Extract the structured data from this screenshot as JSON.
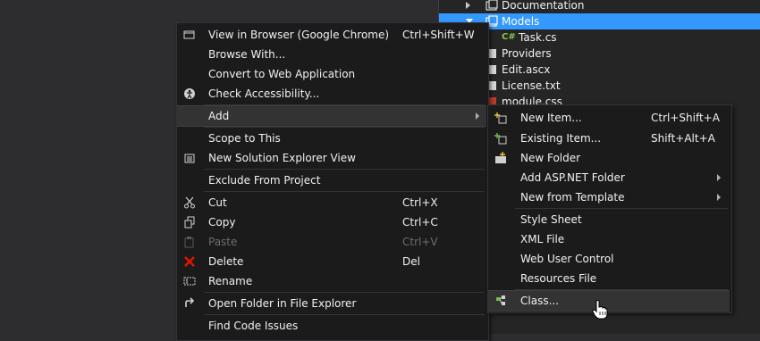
{
  "solution_explorer": {
    "items": [
      {
        "label": "Documentation",
        "icon": "folder-icon"
      },
      {
        "label": "Models",
        "icon": "folder-icon",
        "selected": true
      },
      {
        "label": "Task.cs",
        "icon": "csharp-file-icon"
      },
      {
        "label": "Providers",
        "icon": "folder-icon"
      },
      {
        "label": "Edit.ascx",
        "icon": "user-control-file-icon"
      },
      {
        "label": "License.txt",
        "icon": "text-file-icon"
      },
      {
        "label": "module.css",
        "icon": "css-file-icon"
      }
    ]
  },
  "context_menu": {
    "items": [
      {
        "label": "View in Browser (Google Chrome)",
        "shortcut": "Ctrl+Shift+W",
        "icon": "browser-icon"
      },
      {
        "label": "Browse With...",
        "shortcut": ""
      },
      {
        "label": "Convert to Web Application",
        "shortcut": ""
      },
      {
        "label": "Check Accessibility...",
        "shortcut": "",
        "icon": "accessibility-icon"
      },
      {
        "label": "Add",
        "shortcut": "",
        "submenu": true,
        "highlighted": true
      },
      {
        "label": "Scope to This",
        "shortcut": ""
      },
      {
        "label": "New Solution Explorer View",
        "shortcut": "",
        "icon": "new-view-icon"
      },
      {
        "label": "Exclude From Project",
        "shortcut": ""
      },
      {
        "label": "Cut",
        "shortcut": "Ctrl+X",
        "icon": "scissors-icon"
      },
      {
        "label": "Copy",
        "shortcut": "Ctrl+C",
        "icon": "copy-icon"
      },
      {
        "label": "Paste",
        "shortcut": "Ctrl+V",
        "icon": "paste-icon",
        "disabled": true
      },
      {
        "label": "Delete",
        "shortcut": "Del",
        "icon": "delete-x-icon"
      },
      {
        "label": "Rename",
        "shortcut": "",
        "icon": "rename-icon"
      },
      {
        "label": "Open Folder in File Explorer",
        "shortcut": "",
        "icon": "open-folder-arrow-icon"
      },
      {
        "label": "Find Code Issues",
        "shortcut": ""
      }
    ]
  },
  "add_submenu": {
    "items": [
      {
        "label": "New Item...",
        "shortcut": "Ctrl+Shift+A",
        "icon": "new-item-icon"
      },
      {
        "label": "Existing Item...",
        "shortcut": "Shift+Alt+A",
        "icon": "existing-item-icon"
      },
      {
        "label": "New Folder",
        "shortcut": "",
        "icon": "new-folder-icon"
      },
      {
        "label": "Add ASP.NET Folder",
        "shortcut": "",
        "submenu": true
      },
      {
        "label": "New from Template",
        "shortcut": "",
        "submenu": true
      },
      {
        "label": "Style Sheet",
        "shortcut": ""
      },
      {
        "label": "XML File",
        "shortcut": ""
      },
      {
        "label": "Web User Control",
        "shortcut": ""
      },
      {
        "label": "Resources File",
        "shortcut": ""
      },
      {
        "label": "Class...",
        "shortcut": "",
        "icon": "class-icon",
        "highlighted": true
      }
    ]
  },
  "colors": {
    "selection": "#3399ff",
    "menu_bg": "#1b1b1c",
    "highlight_bg": "#333334",
    "delete_red": "#e51400",
    "csharp_green": "#8bc34a"
  }
}
